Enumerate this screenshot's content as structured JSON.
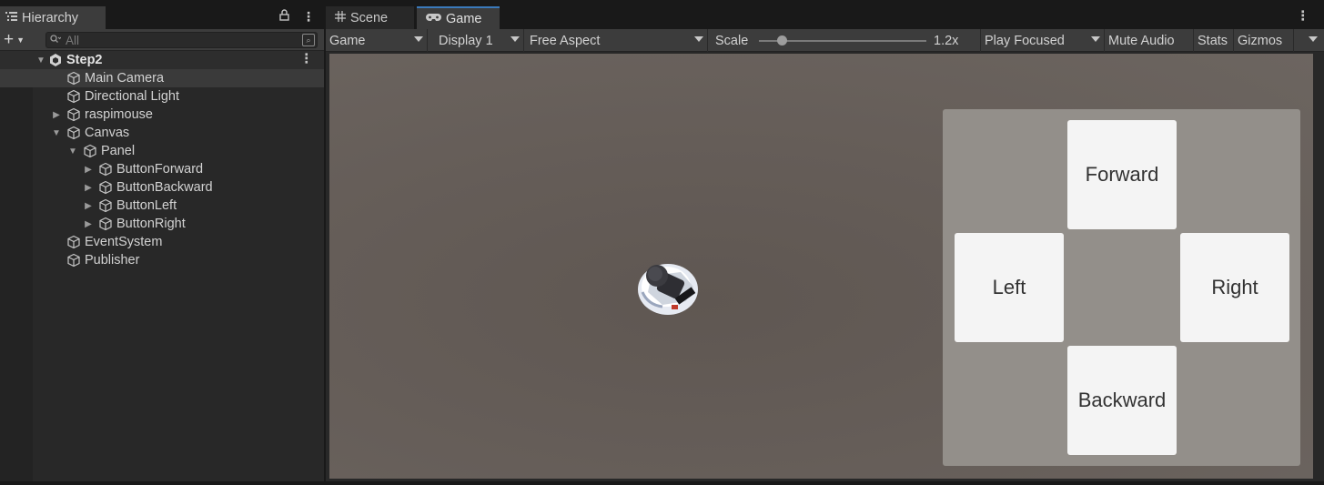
{
  "hierarchy": {
    "tab_label": "Hierarchy",
    "search_placeholder": "All",
    "scene_name": "Step2",
    "items": [
      {
        "label": "Main Camera"
      },
      {
        "label": "Directional Light"
      },
      {
        "label": "raspimouse"
      },
      {
        "label": "Canvas"
      },
      {
        "label": "Panel"
      },
      {
        "label": "ButtonForward"
      },
      {
        "label": "ButtonBackward"
      },
      {
        "label": "ButtonLeft"
      },
      {
        "label": "ButtonRight"
      },
      {
        "label": "EventSystem"
      },
      {
        "label": "Publisher"
      }
    ]
  },
  "tabs": {
    "scene": "Scene",
    "game": "Game"
  },
  "game_toolbar": {
    "view_mode": "Game",
    "display": "Display 1",
    "aspect": "Free Aspect",
    "scale_label": "Scale",
    "scale_value": "1.2x",
    "play_mode": "Play Focused",
    "mute_audio": "Mute Audio",
    "stats": "Stats",
    "gizmos": "Gizmos"
  },
  "game_ui": {
    "forward": "Forward",
    "left": "Left",
    "right": "Right",
    "backward": "Backward"
  },
  "icons": {
    "hierarchy_tab": "list-icon",
    "lock": "lock-icon",
    "scene_tab": "grid-icon",
    "game_tab": "gamepad-icon",
    "search": "search-icon",
    "gameobject": "cube-icon",
    "scene_root": "unity-logo-icon"
  },
  "colors": {
    "active_tab_accent": "#3a79bb",
    "viewport_bg": "#655d58",
    "ui_panel": "#938f8a",
    "ui_button": "#f4f4f4"
  }
}
